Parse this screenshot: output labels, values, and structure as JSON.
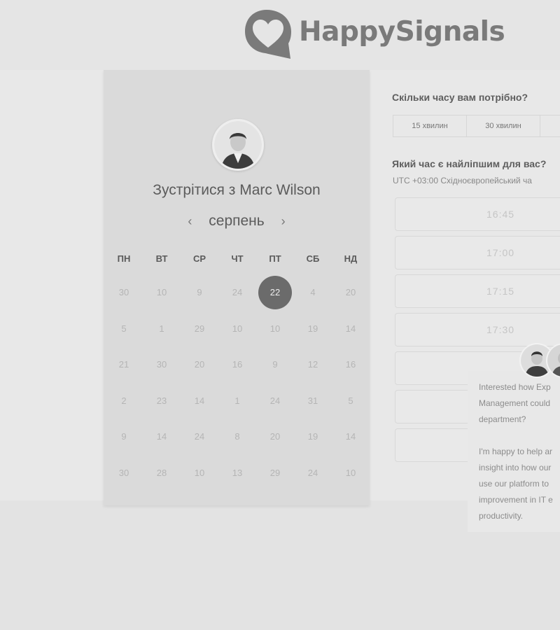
{
  "brand": {
    "name": "HappySignals"
  },
  "calendar": {
    "title": "Зустрітися з Marc Wilson",
    "month": "серпень",
    "prev_icon": "‹",
    "next_icon": "›",
    "weekdays": [
      "ПН",
      "ВТ",
      "СР",
      "ЧТ",
      "ПТ",
      "СБ",
      "НД"
    ],
    "weeks": [
      [
        "30",
        "10",
        "9",
        "24",
        "22",
        "4",
        "20"
      ],
      [
        "5",
        "1",
        "29",
        "10",
        "10",
        "19",
        "14"
      ],
      [
        "21",
        "30",
        "20",
        "16",
        "9",
        "12",
        "16"
      ],
      [
        "2",
        "23",
        "14",
        "1",
        "24",
        "31",
        "5"
      ],
      [
        "9",
        "14",
        "24",
        "8",
        "20",
        "19",
        "14"
      ],
      [
        "30",
        "28",
        "10",
        "13",
        "29",
        "24",
        "10"
      ]
    ],
    "selected": {
      "week": 0,
      "day": 4
    }
  },
  "duration": {
    "question": "Скільки часу вам потрібно?",
    "options": [
      "15 хвилин",
      "30 хвилин",
      ""
    ]
  },
  "time": {
    "question": "Який час є найліпшим для вас?",
    "timezone": "UTC +03:00 Східноєвропейський ча",
    "slots": [
      "16:45",
      "17:00",
      "17:15",
      "17:30",
      "",
      "",
      ""
    ]
  },
  "chat": {
    "message": "Interested how Exp\nManagement could\ndepartment?\n\nI'm happy to help ar\ninsight into how our\nuse our platform to\nimprovement in IT e\nproductivity."
  },
  "colors": {
    "selected_day": "#6b6b6b",
    "logo": "#7a7a7a"
  }
}
